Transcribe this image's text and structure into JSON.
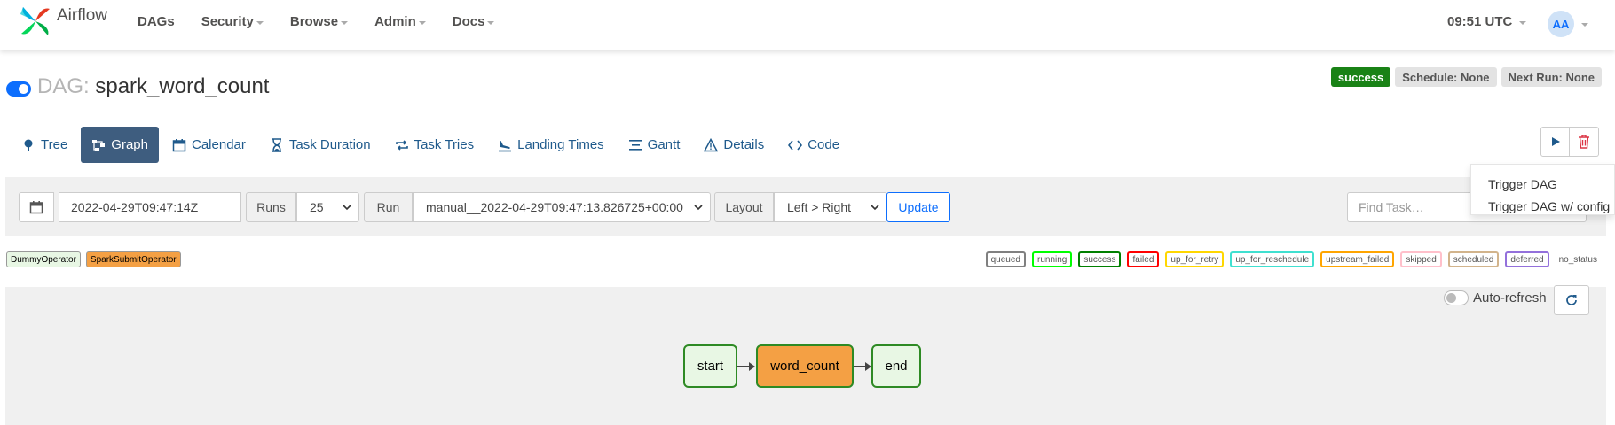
{
  "brand": {
    "name": "Airflow"
  },
  "nav": {
    "items": [
      {
        "label": "DAGs",
        "dropdown": false
      },
      {
        "label": "Security",
        "dropdown": true
      },
      {
        "label": "Browse",
        "dropdown": true
      },
      {
        "label": "Admin",
        "dropdown": true
      },
      {
        "label": "Docs",
        "dropdown": true
      }
    ],
    "time": "09:51 UTC",
    "user_initials": "AA"
  },
  "dag": {
    "prefix": "DAG:",
    "name": "spark_word_count",
    "paused": false,
    "status": "success",
    "schedule": "Schedule: None",
    "next_run": "Next Run: None"
  },
  "tabs": [
    {
      "label": "Tree",
      "icon": "tree-icon",
      "active": false
    },
    {
      "label": "Graph",
      "icon": "graph-icon",
      "active": true
    },
    {
      "label": "Calendar",
      "icon": "calendar-icon",
      "active": false
    },
    {
      "label": "Task Duration",
      "icon": "hourglass-icon",
      "active": false
    },
    {
      "label": "Task Tries",
      "icon": "repeat-icon",
      "active": false
    },
    {
      "label": "Landing Times",
      "icon": "plane-landing-icon",
      "active": false
    },
    {
      "label": "Gantt",
      "icon": "gantt-icon",
      "active": false
    },
    {
      "label": "Details",
      "icon": "warning-triangle-icon",
      "active": false
    },
    {
      "label": "Code",
      "icon": "code-icon",
      "active": false
    }
  ],
  "trigger_menu": {
    "items": [
      "Trigger DAG",
      "Trigger DAG w/ config"
    ]
  },
  "filters": {
    "execution_date": "2022-04-29T09:47:14Z",
    "runs_label": "Runs",
    "runs_value": "25",
    "run_label": "Run",
    "run_value": "manual__2022-04-29T09:47:13.826725+00:00",
    "layout_label": "Layout",
    "layout_value": "Left > Right",
    "update_label": "Update",
    "find_task_placeholder": "Find Task…"
  },
  "operators": [
    {
      "label": "DummyOperator",
      "color": "#e8f7e4"
    },
    {
      "label": "SparkSubmitOperator",
      "color": "#f4a044"
    }
  ],
  "states": [
    {
      "label": "queued",
      "color": "#808080"
    },
    {
      "label": "running",
      "color": "#00ff00"
    },
    {
      "label": "success",
      "color": "#008000"
    },
    {
      "label": "failed",
      "color": "#ff0000"
    },
    {
      "label": "up_for_retry",
      "color": "#ffd700"
    },
    {
      "label": "up_for_reschedule",
      "color": "#40e0d0"
    },
    {
      "label": "upstream_failed",
      "color": "#ffa500"
    },
    {
      "label": "skipped",
      "color": "#ffc0cb"
    },
    {
      "label": "scheduled",
      "color": "#d2b48c"
    },
    {
      "label": "deferred",
      "color": "#9370db"
    },
    {
      "label": "no_status",
      "color": ""
    }
  ],
  "graph": {
    "auto_refresh_label": "Auto-refresh",
    "auto_refresh_on": false,
    "nodes": [
      {
        "id": "start",
        "operator": "DummyOperator",
        "state": "success"
      },
      {
        "id": "word_count",
        "operator": "SparkSubmitOperator",
        "state": "success"
      },
      {
        "id": "end",
        "operator": "DummyOperator",
        "state": "success"
      }
    ],
    "edges": [
      [
        "start",
        "word_count"
      ],
      [
        "word_count",
        "end"
      ]
    ]
  }
}
